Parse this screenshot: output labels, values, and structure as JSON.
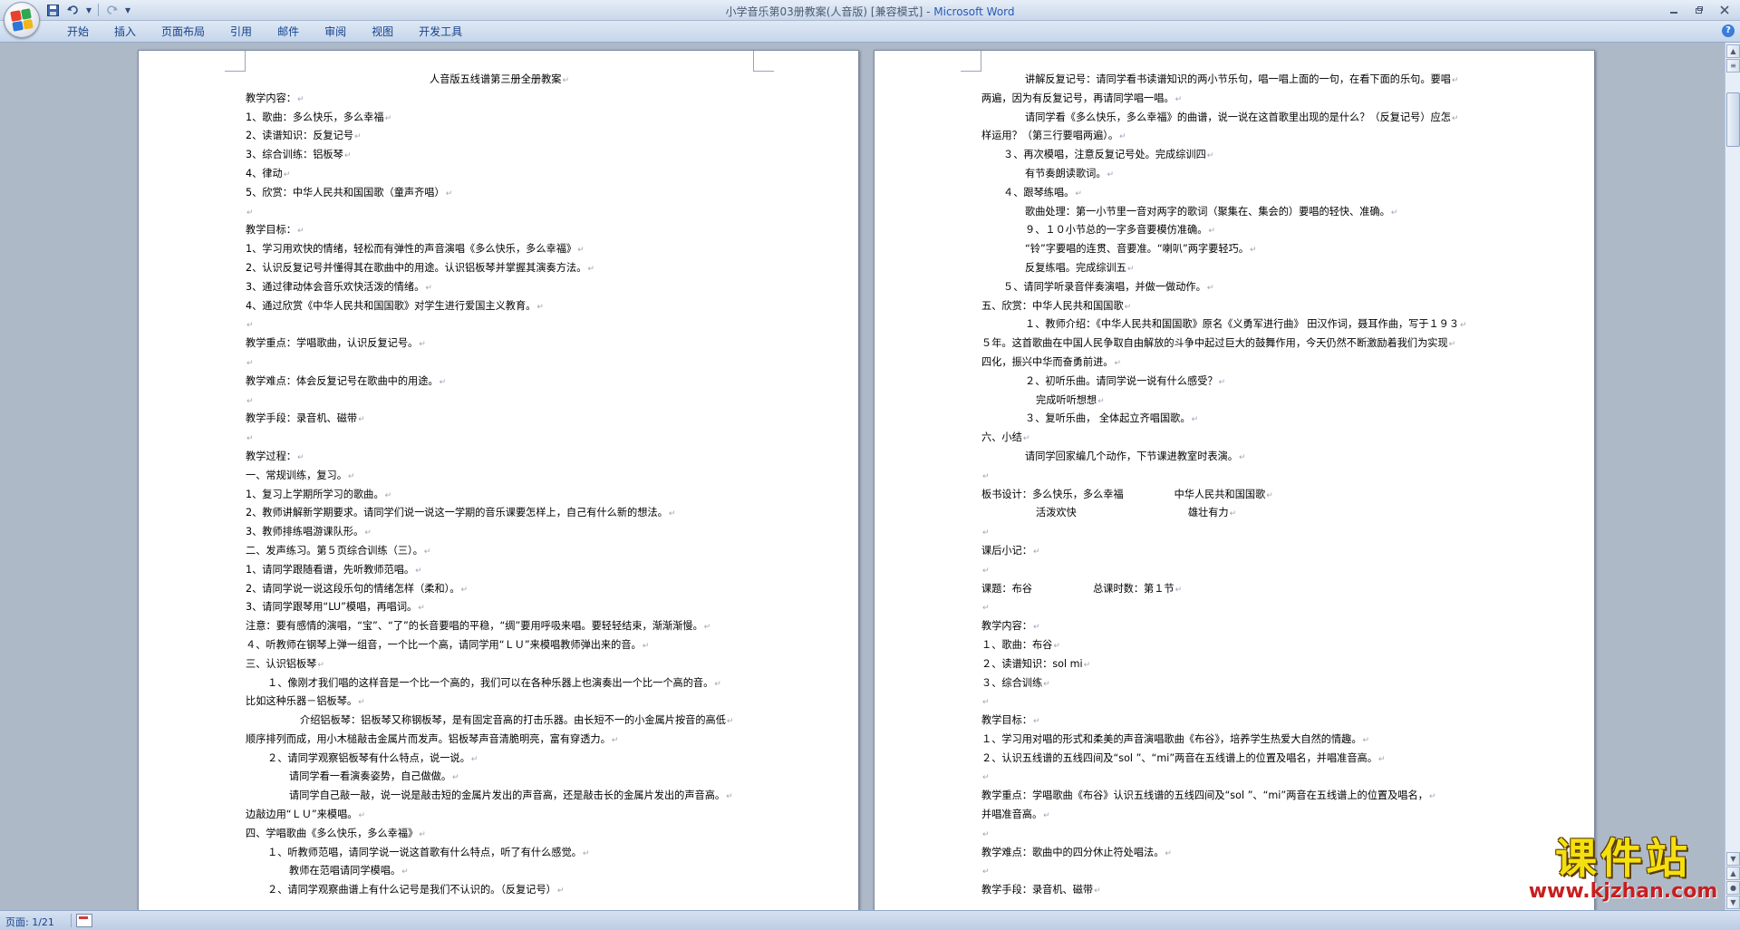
{
  "window": {
    "title_doc": "小学音乐第03册教案(人音版) [兼容模式] - ",
    "title_app": "Microsoft Word"
  },
  "quick_access": {
    "save_icon": "save-icon",
    "undo_icon": "undo-icon",
    "redo_icon": "redo-icon",
    "customize_icon": "dropdown-arrow-icon"
  },
  "ribbon": {
    "tabs": [
      "开始",
      "插入",
      "页面布局",
      "引用",
      "邮件",
      "审阅",
      "视图",
      "开发工具"
    ]
  },
  "page1": {
    "lines": [
      "人音版五线谱第三册全册教案",
      "教学内容：",
      "1、歌曲：多么快乐，多么幸福",
      "2、读谱知识：反复记号",
      "3、综合训练：铝板琴",
      "4、律动",
      "5、欣赏：中华人民共和国国歌（童声齐唱）",
      "",
      "教学目标：",
      "1、学习用欢快的情绪，轻松而有弹性的声音演唱《多么快乐，多么幸福》",
      "2、认识反复记号并懂得其在歌曲中的用途。认识铝板琴并掌握其演奏方法。",
      "3、通过律动体会音乐欢快活泼的情绪。",
      "4、通过欣赏《中华人民共和国国歌》对学生进行爱国主义教育。",
      "",
      "教学重点：学唱歌曲，认识反复记号。",
      "",
      "教学难点：体会反复记号在歌曲中的用途。",
      "",
      "教学手段：录音机、磁带",
      "",
      "教学过程：",
      "一、常规训练，复习。",
      "1、复习上学期所学习的歌曲。",
      "2、教师讲解新学期要求。请同学们说一说这一学期的音乐课要怎样上，自己有什么新的想法。",
      "3、教师排练唱游课队形。",
      "二、发声练习。第５页综合训练（三）。",
      "1、请同学跟随看谱，先听教师范唱。",
      "2、请同学说一说这段乐句的情绪怎样（柔和）。",
      "3、请同学跟琴用“LU”模唱，再唱词。",
      "注意：要有感情的演唱，“宝”、“了”的长音要唱的平稳，“绸”要用呼吸来唱。要轻轻结束，渐渐渐慢。",
      "４、听教师在钢琴上弹一组音，一个比一个高，请同学用“ＬＵ”来模唱教师弹出来的音。",
      "三、认识铝板琴",
      "１、像刚才我们唱的这样音是一个比一个高的，我们可以在各种乐器上也演奏出一个比一个高的音。",
      "比如这种乐器－铝板琴。",
      "介绍铝板琴：铝板琴又称钢板琴，是有固定音高的打击乐器。由长短不一的小金属片按音的高低",
      "顺序排列而成，用小木槌敲击金属片而发声。铝板琴声音清脆明亮，富有穿透力。",
      "２、请同学观察铝板琴有什么特点，说一说。",
      "请同学看一看演奏姿势，自己做做。",
      "请同学自己敲一敲，说一说是敲击短的金属片发出的声音高，还是敲击长的金属片发出的声音高。",
      "边敲边用“ＬＵ”来模唱。",
      "四、学唱歌曲《多么快乐，多么幸福》",
      "１、听教师范唱，请同学说一说这首歌有什么特点，听了有什么感觉。",
      "教师在范唱请同学模唱。",
      "２、请同学观察曲谱上有什么记号是我们不认识的。（反复记号）"
    ],
    "indent": [
      0,
      0,
      0,
      0,
      0,
      0,
      0,
      0,
      0,
      0,
      0,
      0,
      0,
      0,
      0,
      0,
      0,
      0,
      0,
      0,
      0,
      0,
      0,
      0,
      0,
      0,
      0,
      0,
      0,
      0,
      0,
      0,
      1,
      0,
      3,
      0,
      1,
      2,
      2,
      0,
      0,
      1,
      2,
      1
    ]
  },
  "page2": {
    "lines": [
      "讲解反复记号：请同学看书读谱知识的两小节乐句，唱一唱上面的一句，在看下面的乐句。要唱",
      "两遍，因为有反复记号，再请同学唱一唱。",
      "请同学看《多么快乐，多么幸福》的曲谱，说一说在这首歌里出现的是什么？（反复记号）应怎",
      "样运用？（第三行要唱两遍）。",
      "３、再次模唱，注意反复记号处。完成综训四",
      "有节奏朗读歌词。",
      "４、跟琴练唱。",
      "歌曲处理：第一小节里一音对两字的歌词（聚集在、集会的）要唱的轻快、准确。",
      "９、１０小节总的一字多音要模仿准确。",
      "“铃”字要唱的连贯、音要准。“喇叭”两字要轻巧。",
      "反复练唱。完成综训五",
      "５、请同学听录音伴奏演唱，并做一做动作。",
      "五、欣赏：中华人民共和国国歌",
      "１、教师介绍：《中华人民共和国国歌》原名《义勇军进行曲》 田汉作词，聂耳作曲，写于１９３",
      "５年。这首歌曲在中国人民争取自由解放的斗争中起过巨大的鼓舞作用，今天仍然不断激励着我们为实现",
      "四化，振兴中华而奋勇前进。",
      "２、初听乐曲。请同学说一说有什么感受？",
      "完成听听想想",
      "３、复听乐曲， 全体起立齐唱国歌。",
      "六、小结",
      "请同学回家编几个动作，下节课进教室时表演。",
      "",
      "板书设计：多么快乐，多么幸福　　　　　中华人民共和国国歌",
      "活泼欢快　　　　　　　　　　　雄壮有力",
      "",
      "课后小记：",
      "",
      "课题：布谷　　　　　　总课时数：第１节",
      "",
      "教学内容：",
      "１、歌曲：布谷",
      "２、读谱知识：sol mi",
      "３、综合训练",
      "",
      "教学目标：",
      "１、学习用对唱的形式和柔美的声音演唱歌曲《布谷》，培养学生热爱大自然的情趣。",
      "２、认识五线谱的五线四间及“sol ”、“mi”两音在五线谱上的位置及唱名，并唱准音高。",
      "",
      "教学重点：学唱歌曲《布谷》认识五线谱的五线四间及“sol ”、“mi”两音在五线谱上的位置及唱名，",
      "并唱准音高。",
      "",
      "教学难点：歌曲中的四分休止符处唱法。",
      "",
      "教学手段：录音机、磁带"
    ],
    "indent": [
      2,
      0,
      2,
      0,
      1,
      2,
      1,
      2,
      2,
      2,
      2,
      1,
      0,
      2,
      0,
      0,
      2,
      3,
      2,
      0,
      2,
      0,
      0,
      3,
      0,
      0,
      0,
      0,
      0,
      0,
      0,
      0,
      0,
      0,
      0,
      0,
      0,
      0,
      0,
      0,
      0,
      0,
      0,
      0
    ]
  },
  "status": {
    "page_label": "页面: 1/21"
  },
  "watermark": {
    "main": "课件站",
    "sub": "www.kjzhan.com"
  },
  "colors": {
    "office_logo": [
      "#e8412c",
      "#2fa84f",
      "#2b78d6",
      "#f3b51b"
    ],
    "title_app": "#2a5ab4",
    "watermark_main": "#f4e010",
    "watermark_sub": "#c81e1e"
  }
}
